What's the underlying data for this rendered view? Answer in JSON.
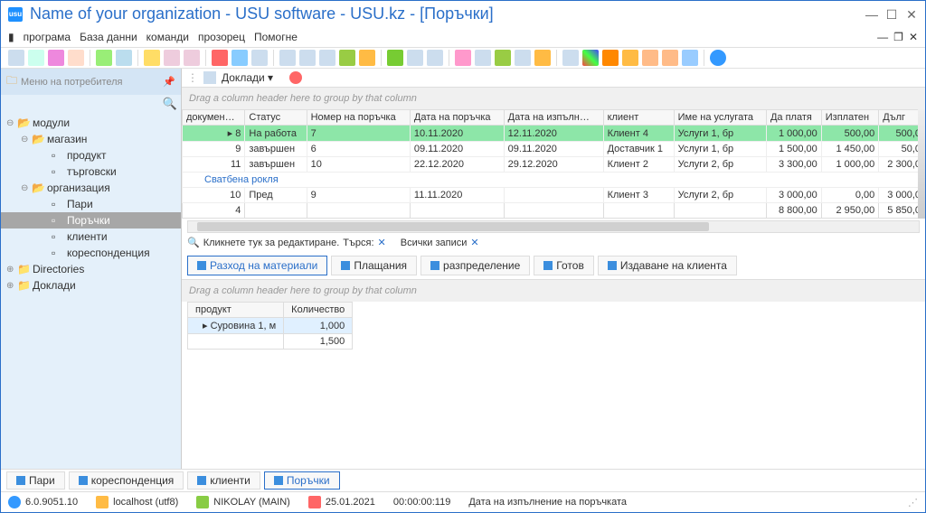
{
  "title": "Name of your organization - USU software - USU.kz - [Поръчки]",
  "menu": {
    "items": [
      "програма",
      "База данни",
      "команди",
      "прозорец",
      "Помогне"
    ]
  },
  "sidebar": {
    "title": "Меню на потребителя",
    "nodes": [
      {
        "label": "модули",
        "lv": 0,
        "expand": "−",
        "icon": "folder-open"
      },
      {
        "label": "магазин",
        "lv": 1,
        "expand": "−",
        "icon": "folder-open"
      },
      {
        "label": "продукт",
        "lv": 2,
        "expand": "",
        "icon": "doc"
      },
      {
        "label": "търговски",
        "lv": 2,
        "expand": "",
        "icon": "doc"
      },
      {
        "label": "организация",
        "lv": 1,
        "expand": "−",
        "icon": "folder-open"
      },
      {
        "label": "Пари",
        "lv": 2,
        "expand": "",
        "icon": "doc"
      },
      {
        "label": "Поръчки",
        "lv": 2,
        "expand": "",
        "icon": "doc",
        "selected": true
      },
      {
        "label": "клиенти",
        "lv": 2,
        "expand": "",
        "icon": "doc"
      },
      {
        "label": "кореспонденция",
        "lv": 2,
        "expand": "",
        "icon": "doc"
      },
      {
        "label": "Directories",
        "lv": 0,
        "expand": "+",
        "icon": "folder"
      },
      {
        "label": "Доклади",
        "lv": 0,
        "expand": "+",
        "icon": "folder"
      }
    ]
  },
  "reports": {
    "label": "Доклади",
    "caret": "▾"
  },
  "grid": {
    "group_hint": "Drag a column header here to group by that column",
    "cols": [
      "докумен…",
      "Статус",
      "Номер на поръчка",
      "Дата на поръчка",
      "Дата на изпълн…",
      "клиент",
      "Име на услугата",
      "Да платя",
      "Изплатен",
      "Дълг"
    ],
    "rows": [
      {
        "hl": true,
        "c": [
          "8",
          "На работа",
          "7",
          "10.11.2020",
          "12.11.2020",
          "Клиент 4",
          "Услуги 1, бр",
          "1 000,00",
          "500,00",
          "500,0"
        ]
      },
      {
        "c": [
          "9",
          "завършен",
          "6",
          "09.11.2020",
          "09.11.2020",
          "Доставчик 1",
          "Услуги 1, бр",
          "1 500,00",
          "1 450,00",
          "50,0"
        ]
      },
      {
        "c": [
          "11",
          "завършен",
          "10",
          "22.12.2020",
          "29.12.2020",
          "Клиент 2",
          "Услуги 2, бр",
          "3 300,00",
          "1 000,00",
          "2 300,0"
        ]
      }
    ],
    "group_row": "Сватбена рокля",
    "group_data": {
      "c": [
        "10",
        "Пред",
        "9",
        "11.11.2020",
        "",
        "Клиент 3",
        "Услуги 2, бр",
        "3 000,00",
        "0,00",
        "3 000,0"
      ]
    },
    "footer": {
      "count": "4",
      "sum1": "8 800,00",
      "sum2": "2 950,00",
      "sum3": "5 850,0"
    }
  },
  "filter": {
    "edit": "Кликнете тук за редактиране.",
    "search_lbl": "Търся:",
    "x1": "✕",
    "all": "Всички записи",
    "x2": "✕"
  },
  "subtabs": [
    "Разход на материали",
    "Плащания",
    "разпределение",
    "Готов",
    "Издаване на клиента"
  ],
  "subgrid": {
    "group_hint": "Drag a column header here to group by that column",
    "cols": [
      "продукт",
      "Количество"
    ],
    "row": [
      "Суровина 1, м",
      "1,000"
    ],
    "footer": "1,500"
  },
  "doc_tabs": [
    "Пари",
    "кореспонденция",
    "клиенти",
    "Поръчки"
  ],
  "status": {
    "version": "6.0.9051.10",
    "host": "localhost (utf8)",
    "user": "NIKOLAY (MAIN)",
    "date": "25.01.2021",
    "time": "00:00:00:119",
    "hint": "Дата на изпълнение на поръчката"
  }
}
